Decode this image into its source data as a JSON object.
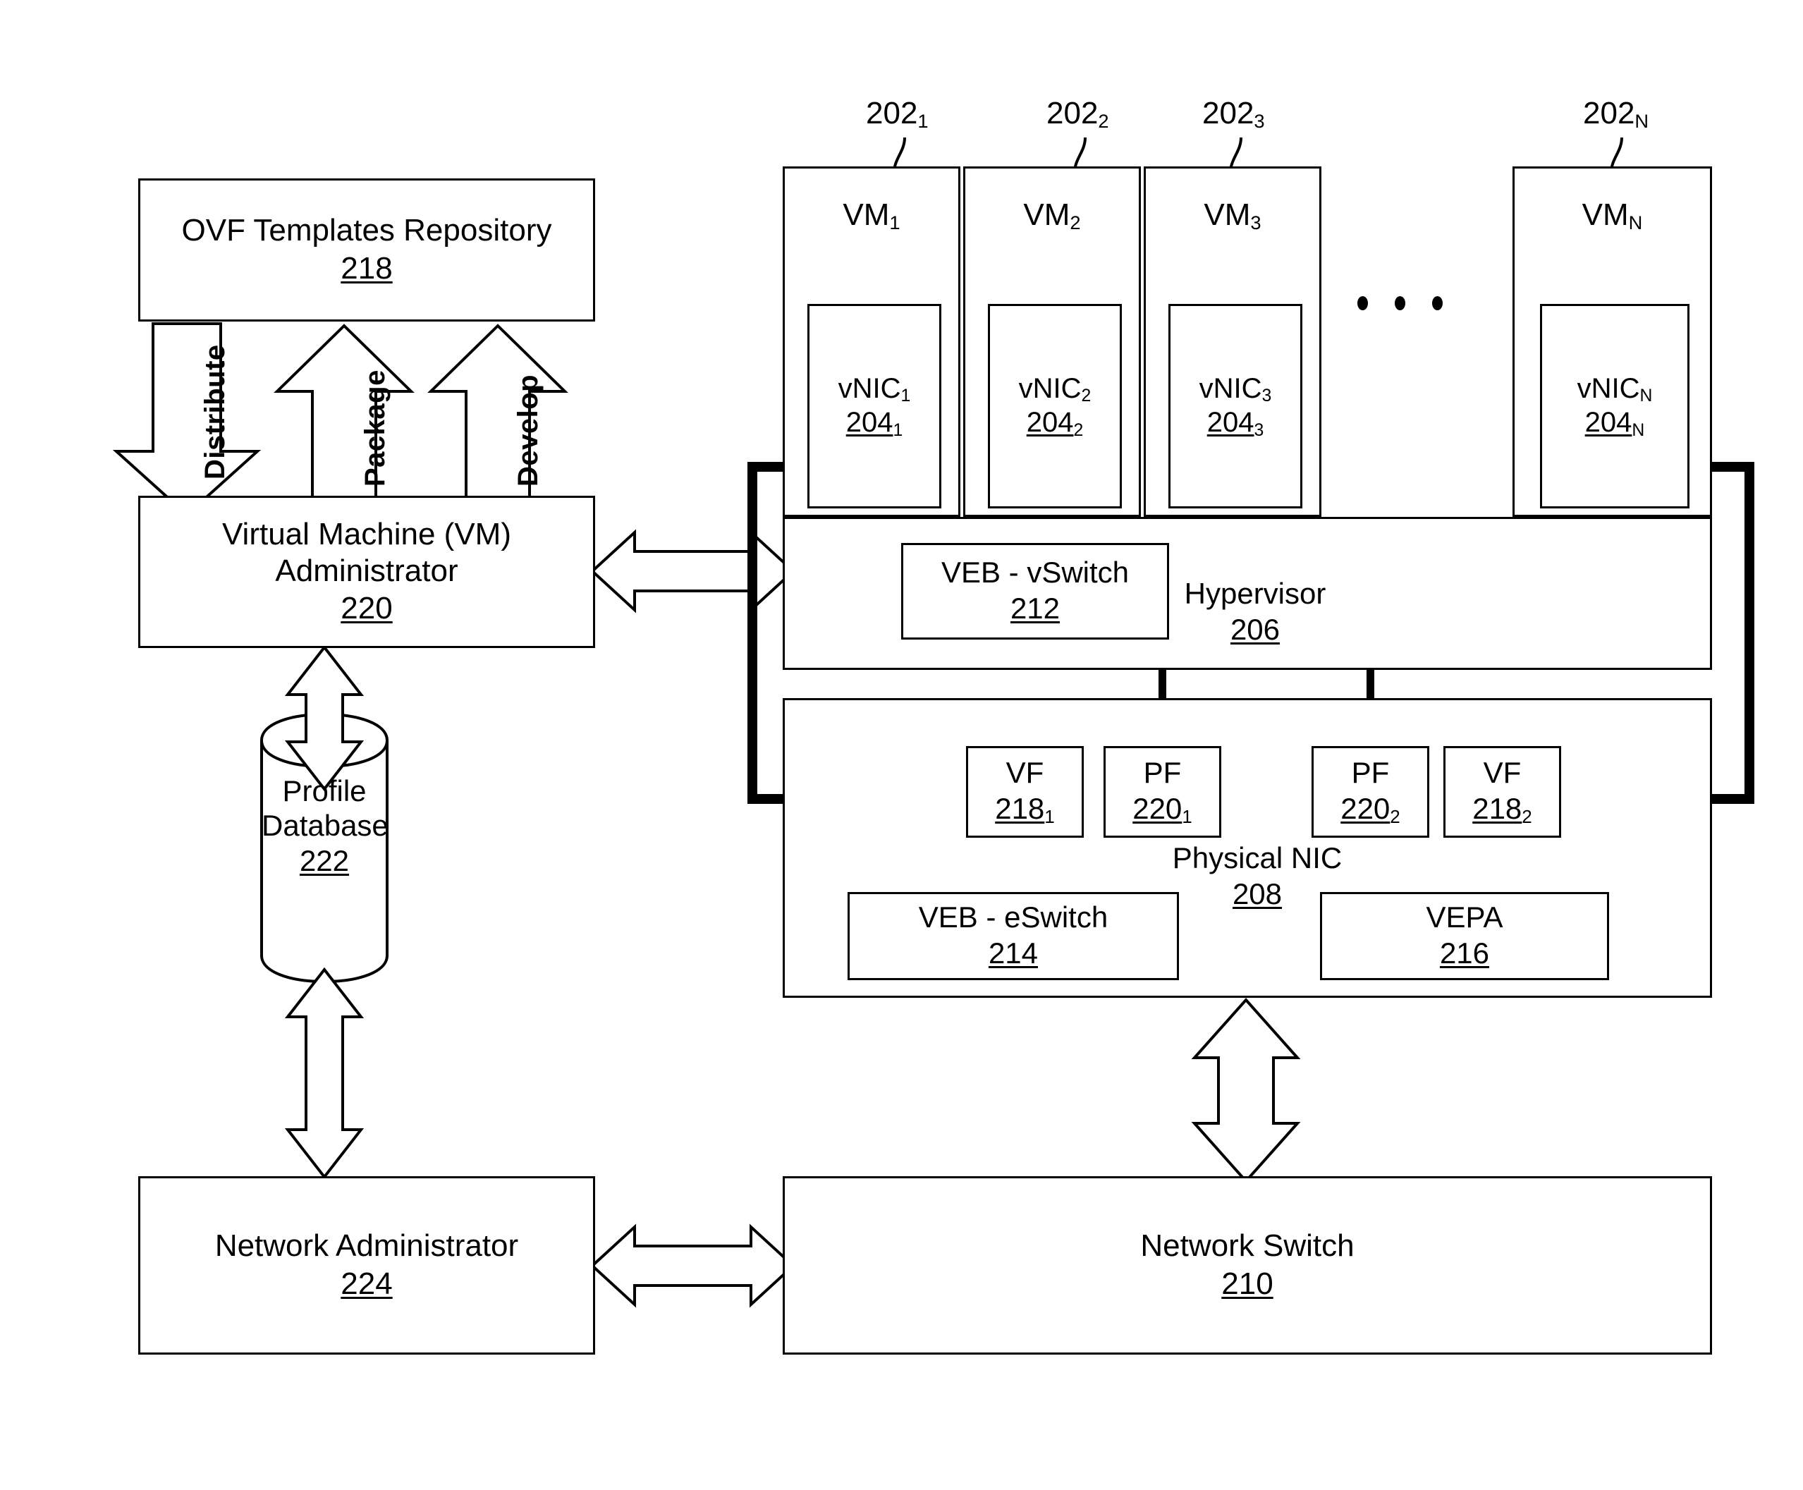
{
  "figure": {
    "title": "Virtualized network architecture block diagram",
    "stroke_color": "#000000",
    "background_color": "#ffffff"
  },
  "left_column": {
    "ovf_repository": {
      "label": "OVF Templates Repository",
      "ref": "218"
    },
    "vm_administrator": {
      "label_line1": "Virtual Machine (VM)",
      "label_line2": "Administrator",
      "ref": "220"
    },
    "profile_database": {
      "label_line1": "Profile",
      "label_line2": "Database",
      "ref": "222"
    },
    "network_administrator": {
      "label": "Network Administrator",
      "ref": "224"
    }
  },
  "process_arrows": [
    {
      "name": "distribute",
      "label": "Distribute",
      "direction": "down"
    },
    {
      "name": "package",
      "label": "Package",
      "direction": "up"
    },
    {
      "name": "develop",
      "label": "Develop",
      "direction": "up"
    }
  ],
  "virtual_machines": [
    {
      "name": "VM",
      "sub": "1",
      "ref_callout": "202",
      "ref_callout_sub": "1",
      "vnic": {
        "name": "vNIC",
        "sub": "1",
        "ref": "204",
        "ref_sub": "1"
      }
    },
    {
      "name": "VM",
      "sub": "2",
      "ref_callout": "202",
      "ref_callout_sub": "2",
      "vnic": {
        "name": "vNIC",
        "sub": "2",
        "ref": "204",
        "ref_sub": "2"
      }
    },
    {
      "name": "VM",
      "sub": "3",
      "ref_callout": "202",
      "ref_callout_sub": "3",
      "vnic": {
        "name": "vNIC",
        "sub": "3",
        "ref": "204",
        "ref_sub": "3"
      }
    },
    {
      "name": "VM",
      "sub": "N",
      "ref_callout": "202",
      "ref_callout_sub": "N",
      "vnic": {
        "name": "vNIC",
        "sub": "N",
        "ref": "204",
        "ref_sub": "N"
      }
    }
  ],
  "ellipsis": "• • •",
  "hypervisor": {
    "label": "Hypervisor",
    "ref": "206",
    "veb_vswitch": {
      "label": "VEB - vSwitch",
      "ref": "212"
    }
  },
  "physical_nic": {
    "label": "Physical NIC",
    "ref": "208",
    "functions": [
      {
        "name": "VF",
        "ref": "218",
        "ref_sub": "1"
      },
      {
        "name": "PF",
        "ref": "220",
        "ref_sub": "1"
      },
      {
        "name": "PF",
        "ref": "220",
        "ref_sub": "2"
      },
      {
        "name": "VF",
        "ref": "218",
        "ref_sub": "2"
      }
    ],
    "veb_eswitch": {
      "label": "VEB - eSwitch",
      "ref": "214"
    },
    "vepa": {
      "label": "VEPA",
      "ref": "216"
    }
  },
  "network_switch": {
    "label": "Network Switch",
    "ref": "210"
  }
}
